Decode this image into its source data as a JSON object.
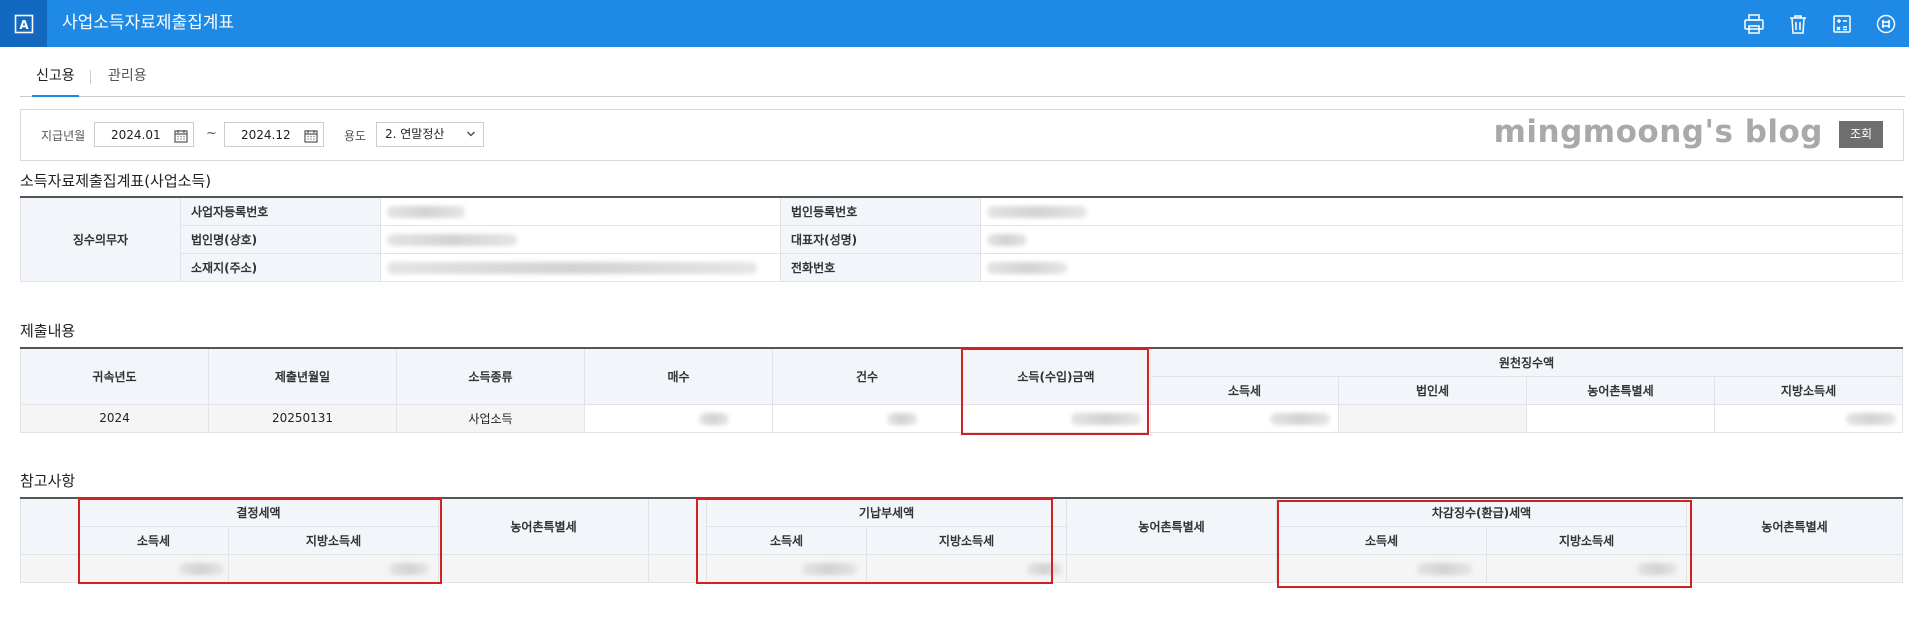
{
  "app": {
    "logo_letter": "A",
    "title": "사업소득자료제출집계표"
  },
  "tabs": [
    {
      "label": "신고용",
      "active": true
    },
    {
      "label": "관리용",
      "active": false
    }
  ],
  "search": {
    "period_label": "지급년월",
    "start_date": "2024.01",
    "range_sep": "~",
    "end_date": "2024.12",
    "purpose_label": "용도",
    "purpose_value": "2. 연말정산",
    "search_button": "조회",
    "watermark": "mingmoong's blog"
  },
  "section1": {
    "title": "소득자료제출집계표(사업소득)",
    "group_label": "징수의무자",
    "rows": [
      {
        "left": "사업자등록번호",
        "right": "법인등록번호"
      },
      {
        "left": "법인명(상호)",
        "right": "대표자(성명)"
      },
      {
        "left": "소재지(주소)",
        "right": "전화번호"
      }
    ]
  },
  "section2": {
    "title": "제출내용",
    "headers": {
      "year": "귀속년도",
      "submit_date": "제출년월일",
      "income_type": "소득종류",
      "count": "매수",
      "cases": "건수",
      "amount": "소득(수입)금액",
      "withholding": "원천징수액",
      "income_tax": "소득세",
      "corp_tax": "법인세",
      "rural_tax": "농어촌특별세",
      "local_tax": "지방소득세"
    },
    "row": {
      "year": "2024",
      "submit_date": "20250131",
      "income_type": "사업소득"
    }
  },
  "section3": {
    "title": "참고사항",
    "groups": {
      "decided": "결정세액",
      "paid": "기납부세액",
      "diff": "차감징수(환급)세액"
    },
    "sub": {
      "income_tax": "소득세",
      "local_tax": "지방소득세",
      "rural_tax": "농어촌특별세"
    }
  },
  "colors": {
    "titlebar": "#1e8ae6",
    "highlight": "#d32020"
  }
}
